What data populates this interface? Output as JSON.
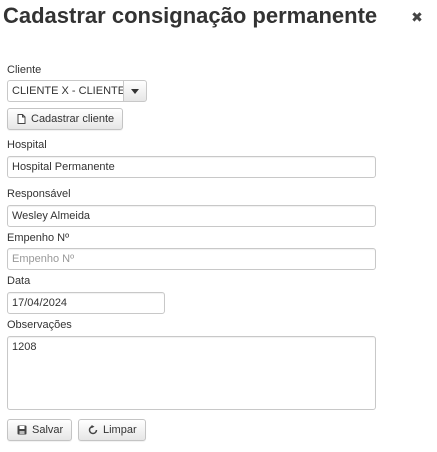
{
  "dialog": {
    "title": "Cadastrar consignação permanente",
    "close_icon": "close-icon"
  },
  "form": {
    "cliente": {
      "label": "Cliente",
      "selected": "CLIENTE X - CLIENTE",
      "caret_icon": "caret-down-icon"
    },
    "cadastrar_cliente": {
      "label": "Cadastrar cliente",
      "icon": "new-file-icon"
    },
    "hospital": {
      "label": "Hospital",
      "value": "Hospital Permanente",
      "placeholder": ""
    },
    "responsavel": {
      "label": "Responsável",
      "value": "Wesley Almeida",
      "placeholder": ""
    },
    "empenho": {
      "label": "Empenho Nº",
      "value": "",
      "placeholder": "Empenho Nº"
    },
    "data": {
      "label": "Data",
      "value": "17/04/2024",
      "placeholder": ""
    },
    "observacoes": {
      "label": "Observações",
      "value": "1208",
      "placeholder": ""
    }
  },
  "actions": {
    "salvar": {
      "label": "Salvar",
      "icon": "save-icon"
    },
    "limpar": {
      "label": "Limpar",
      "icon": "refresh-icon"
    }
  }
}
